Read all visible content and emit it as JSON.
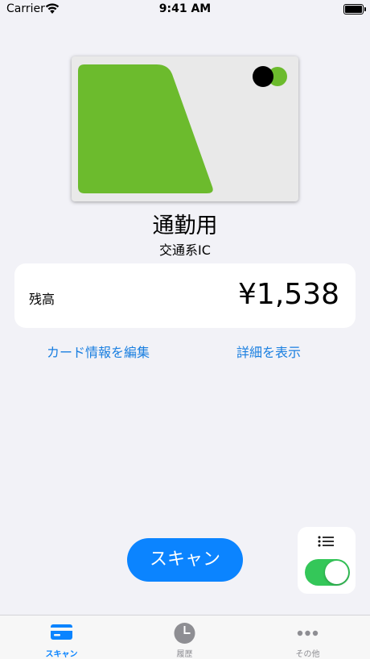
{
  "status_bar": {
    "carrier": "Carrier",
    "time": "9:41 AM"
  },
  "card": {
    "name": "通勤用",
    "type": "交通系IC",
    "colors": {
      "background": "#e9e9e9",
      "accent": "#6cbb2d",
      "dot_dark": "#000000"
    }
  },
  "balance": {
    "label": "残高",
    "value": "¥1,538"
  },
  "links": {
    "edit": "カード情報を編集",
    "detail": "詳細を表示"
  },
  "scan_button": {
    "label": "スキャン"
  },
  "mode_toggle": {
    "icon": "list-icon",
    "on": true
  },
  "tabs": [
    {
      "label": "スキャン",
      "icon": "card-icon",
      "active": true
    },
    {
      "label": "履歴",
      "icon": "clock-icon",
      "active": false
    },
    {
      "label": "その他",
      "icon": "ellipsis-icon",
      "active": false
    }
  ],
  "colors": {
    "accent": "#0b84ff",
    "toggle_on": "#34c759",
    "link": "#1a7fe0"
  }
}
